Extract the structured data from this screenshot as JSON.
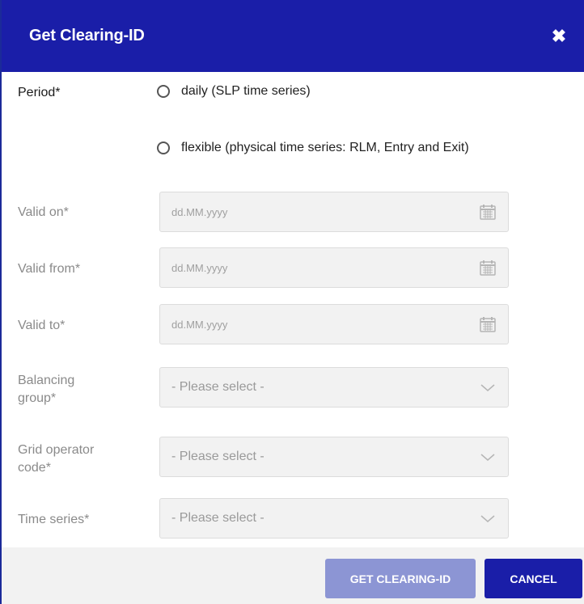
{
  "dialog": {
    "title": "Get Clearing-ID",
    "close_icon": "close-icon"
  },
  "period": {
    "label": "Period*",
    "options": [
      {
        "label": "daily (SLP time series)"
      },
      {
        "label": "flexible (physical time series: RLM, Entry and Exit)"
      }
    ]
  },
  "valid_on": {
    "label": "Valid on*",
    "placeholder": "dd.MM.yyyy",
    "icon": "calendar-icon"
  },
  "valid_from": {
    "label": "Valid from*",
    "placeholder": "dd.MM.yyyy",
    "icon": "calendar-icon"
  },
  "valid_to": {
    "label": "Valid to*",
    "placeholder": "dd.MM.yyyy",
    "icon": "calendar-icon"
  },
  "balancing_group": {
    "label_line1": "Balancing",
    "label_line2": "group*",
    "placeholder": "- Please select -"
  },
  "grid_operator_code": {
    "label_line1": "Grid operator",
    "label_line2": "code*",
    "placeholder": "- Please select -"
  },
  "time_series": {
    "label": "Time series*",
    "placeholder": "- Please select -"
  },
  "buttons": {
    "primary": "GET CLEARING-ID",
    "cancel": "CANCEL"
  },
  "colors": {
    "header": "#1a1ea8",
    "primary_button": "#8c95d4",
    "cancel_button": "#1a1ea8"
  }
}
